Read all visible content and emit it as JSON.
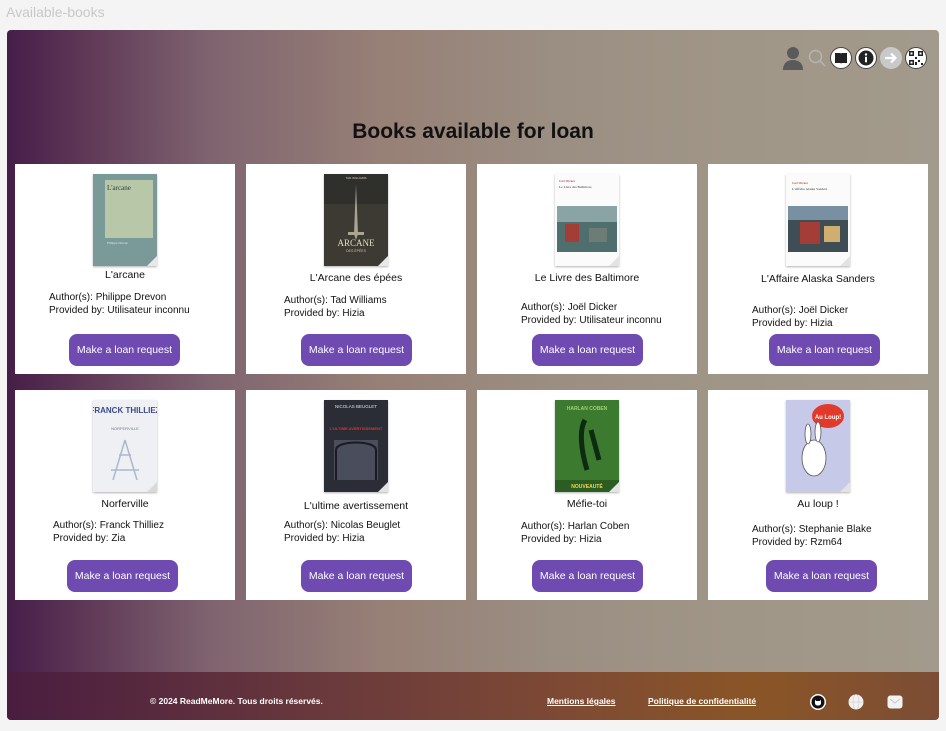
{
  "window": {
    "title": "Available-books"
  },
  "page": {
    "heading": "Books available for loan"
  },
  "labels": {
    "author_prefix": "Author(s): ",
    "provider_prefix": "Provided by: "
  },
  "books": [
    {
      "title": "L'arcane",
      "author": "Philippe Drevon",
      "provider": "Utilisateur inconnu",
      "button": "Make a loan request"
    },
    {
      "title": "L'Arcane des épées",
      "author": "Tad Williams",
      "provider": "Hizia",
      "button": "Make a loan request"
    },
    {
      "title": "Le Livre des Baltimore",
      "author": "Joël Dicker",
      "provider": "Utilisateur inconnu",
      "button": "Make a loan request"
    },
    {
      "title": "L'Affaire Alaska Sanders",
      "author": "Joël Dicker",
      "provider": "Hizia",
      "button": "Make a loan request"
    },
    {
      "title": "Norferville",
      "author": "Franck Thilliez",
      "provider": "Zia",
      "button": "Make a loan request"
    },
    {
      "title": "L'ultime avertissement",
      "author": "Nicolas Beuglet",
      "provider": "Hizia",
      "button": "Make a loan request"
    },
    {
      "title": "Méfie-toi",
      "author": "Harlan Coben",
      "provider": "Hizia",
      "button": "Make a loan request"
    },
    {
      "title": "Au loup !",
      "author": "Stephanie Blake",
      "provider": "Rzm64",
      "button": "Make a loan request"
    }
  ],
  "covers": [
    {
      "text": "L'arcane",
      "sub": "Philippe Drevon"
    },
    {
      "text": "ARCANE",
      "top": "TAD WILLIAMS",
      "sub": "DES ÉPÉES"
    },
    {
      "top": "Joël Dicker",
      "text": "Le Livre des Baltimore"
    },
    {
      "top": "Joël Dicker",
      "text": "L'Affaire Alaska Sanders"
    },
    {
      "top": "FRANCK THILLIEZ",
      "sub": "NORFERVILLE"
    },
    {
      "top": "NICOLAS BEUGLET",
      "text": "L'ULTIME AVERTISSEMENT"
    },
    {
      "top": "HARLAN COBEN",
      "sub": "NOUVEAUTÉ"
    },
    {
      "top": "Au Loup!"
    }
  ],
  "footer": {
    "copyright": "© 2024 ReadMeMore. Tous droits réservés.",
    "legal": "Mentions légales",
    "privacy": "Politique de confidentialité"
  },
  "icons": [
    "user-icon",
    "search-icon",
    "book-icon",
    "info-icon",
    "arrow-right-icon",
    "qr-code-icon",
    "github-icon",
    "globe-icon",
    "mail-icon"
  ]
}
